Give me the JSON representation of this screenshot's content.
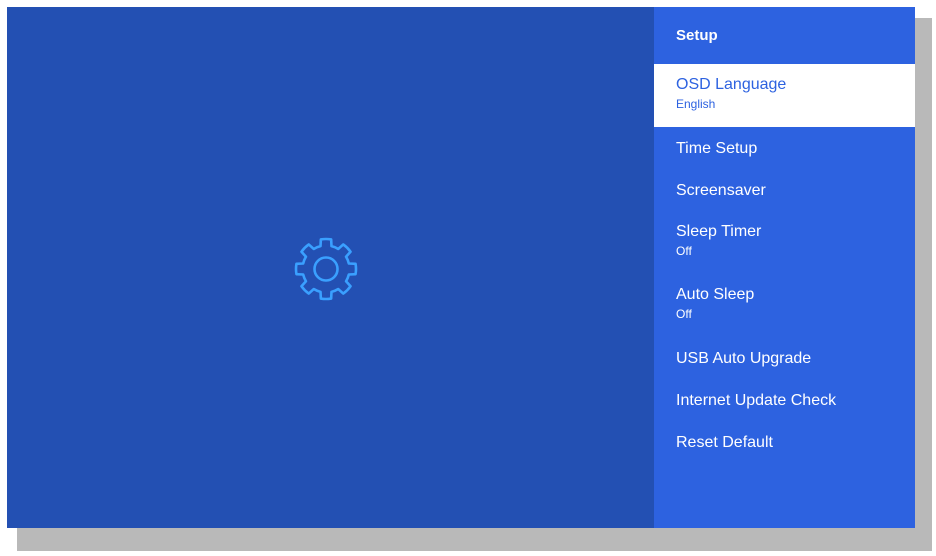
{
  "colors": {
    "background": "#2350b3",
    "panel": "#2d62e0",
    "selected_bg": "#ffffff",
    "selected_text": "#2d62e0",
    "gear_icon": "#3aa0ff"
  },
  "preview": {
    "icon": "gear-icon"
  },
  "panel": {
    "title": "Setup",
    "items": [
      {
        "label": "OSD Language",
        "value": "English",
        "selected": true
      },
      {
        "label": "Time Setup"
      },
      {
        "label": "Screensaver"
      },
      {
        "label": "Sleep Timer",
        "value": "Off"
      },
      {
        "label": "Auto Sleep",
        "value": "Off"
      },
      {
        "label": "USB Auto Upgrade"
      },
      {
        "label": "Internet Update Check"
      },
      {
        "label": "Reset Default"
      }
    ]
  }
}
